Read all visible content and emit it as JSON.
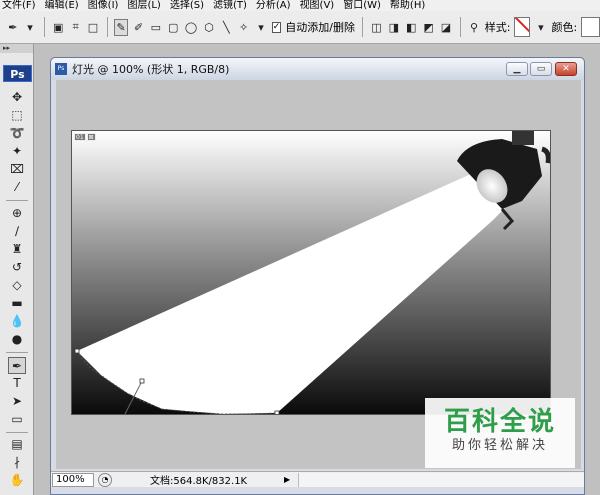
{
  "menu": [
    "文件(F)",
    "编辑(E)",
    "图像(I)",
    "图层(L)",
    "选择(S)",
    "滤镜(T)",
    "分析(A)",
    "视图(V)",
    "窗口(W)",
    "帮助(H)"
  ],
  "options": {
    "auto_add_delete_label": "自动添加/删除",
    "style_label": "样式:",
    "color_label": "颜色:"
  },
  "toolbox": {
    "logo": "Ps"
  },
  "document": {
    "title": "灯光 @ 100% (形状 1, RGB/8)",
    "slice_badge": [
      "01",
      "⊠"
    ],
    "zoom": "100%",
    "doc_info": "文档:564.8K/832.1K"
  },
  "watermark": {
    "main": "百科全说",
    "sub": "助你轻松解决"
  },
  "colors": {
    "accent": "#2f9e4b",
    "titlebar": "#cdd5e2",
    "close": "#c8402c"
  }
}
